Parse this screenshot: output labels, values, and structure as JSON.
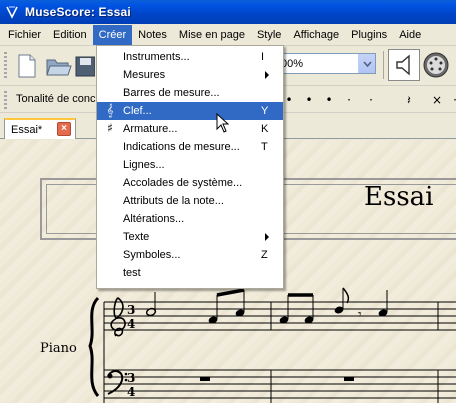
{
  "window": {
    "title": "MuseScore: Essai"
  },
  "menubar": {
    "items": [
      "Fichier",
      "Edition",
      "Créer",
      "Notes",
      "Mise en page",
      "Style",
      "Affichage",
      "Plugins",
      "Aide"
    ],
    "active": "Créer"
  },
  "toolbar": {
    "zoom": "00%",
    "key_label": "Tonalité de conce"
  },
  "tabs": [
    {
      "label": "Essai*"
    }
  ],
  "score": {
    "title": "Essai",
    "instrument": "Piano"
  },
  "dropdown": {
    "items": [
      {
        "label": "Instruments...",
        "shortcut": "I"
      },
      {
        "label": "Mesures",
        "submenu": true
      },
      {
        "label": "Barres de mesure..."
      },
      {
        "label": "Clef...",
        "shortcut": "Y",
        "icon": "treble-clef-icon",
        "highlighted": true
      },
      {
        "label": "Armature...",
        "shortcut": "K",
        "icon": "sharp-icon"
      },
      {
        "label": "Indications de mesure...",
        "shortcut": "T"
      },
      {
        "label": "Lignes..."
      },
      {
        "label": "Accolades de système..."
      },
      {
        "label": "Attributs de la note..."
      },
      {
        "label": "Altérations..."
      },
      {
        "label": "Texte",
        "submenu": true
      },
      {
        "label": "Symboles...",
        "shortcut": "Z"
      },
      {
        "label": "test"
      }
    ]
  },
  "colors": {
    "titlebar": "#0054e3",
    "highlight": "#316ac5",
    "menu_bg": "#ece9d8",
    "paper": "#f0ead9"
  }
}
